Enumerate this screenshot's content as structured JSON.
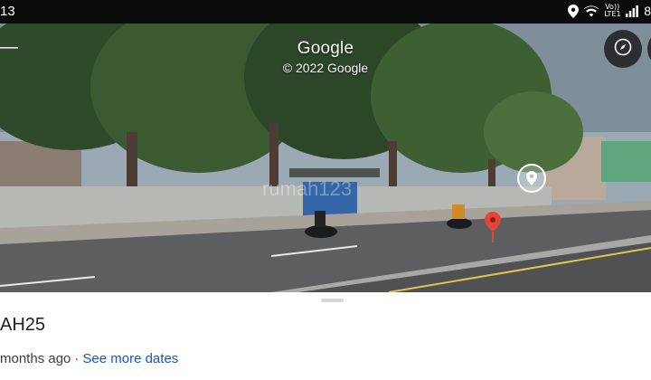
{
  "status_bar": {
    "time": "13",
    "network": "Vo)) LTE1",
    "battery": "8",
    "icons": [
      "location-icon",
      "wifi-icon",
      "signal-icon"
    ]
  },
  "street_view": {
    "attribution_brand": "Google",
    "attribution_copyright": "© 2022 Google",
    "watermark": "rumah123",
    "controls": [
      "back-arrow-icon",
      "compass-icon",
      "location-marker-icon",
      "red-pin-icon"
    ]
  },
  "sheet": {
    "title": "AH25",
    "date_text": "months ago",
    "separator": "·",
    "see_more_link": "See more dates"
  },
  "colors": {
    "status_bar_bg": "#0b0b0b",
    "link": "#1a57b8",
    "pin_red": "#e0473a",
    "title_text": "#202124"
  }
}
